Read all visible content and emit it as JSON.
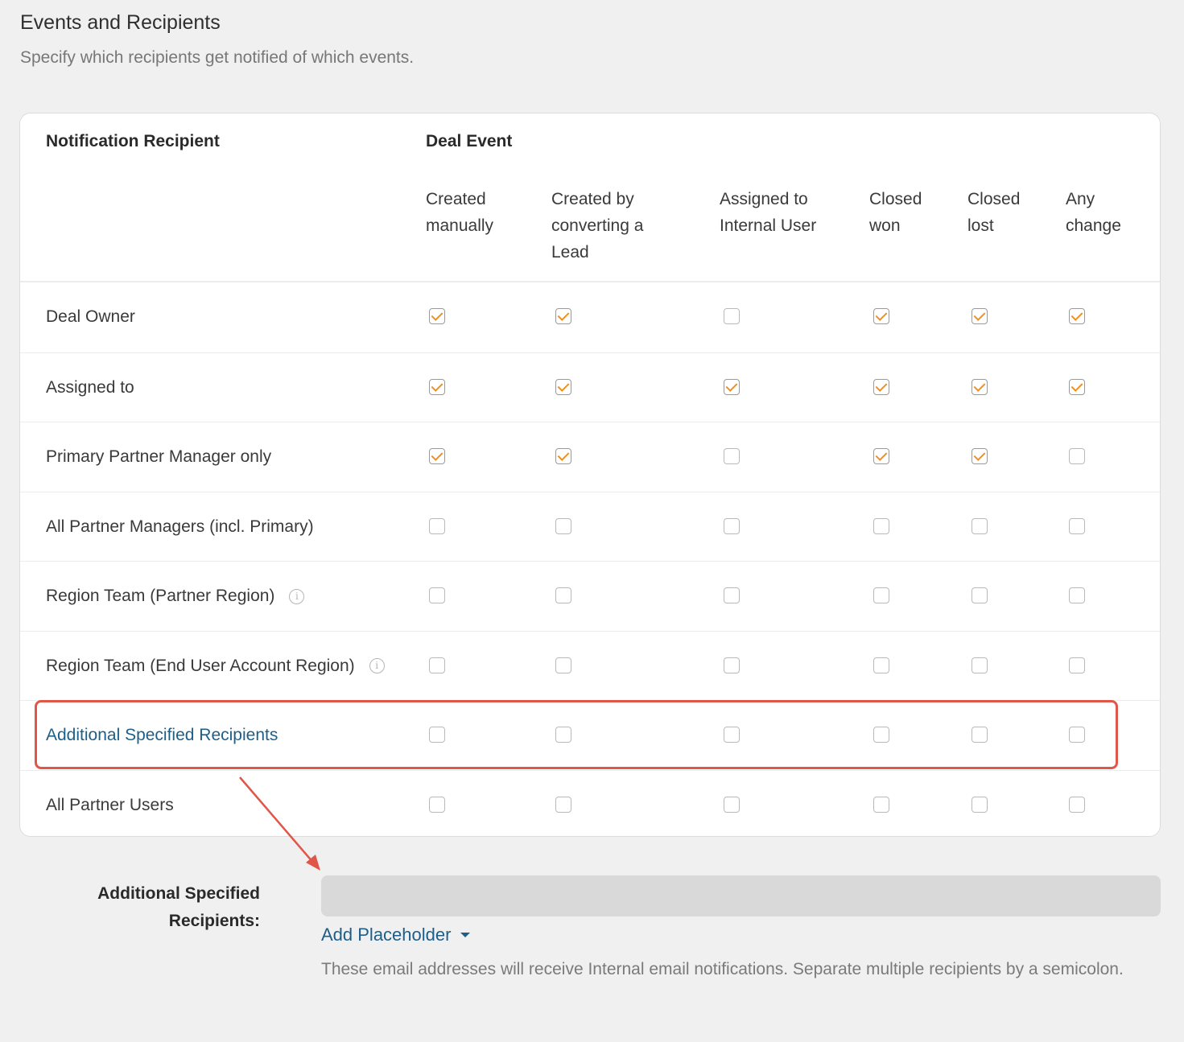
{
  "section": {
    "title": "Events and Recipients",
    "subtitle": "Specify which recipients get notified of which events."
  },
  "table": {
    "recipient_header": "Notification Recipient",
    "event_header": "Deal Event",
    "columns": [
      "Created\nmanually",
      "Created by\nconverting a\nLead",
      "Assigned to\nInternal User",
      "Closed\nwon",
      "Closed\nlost",
      "Any\nchange"
    ],
    "rows": [
      {
        "label": "Deal Owner",
        "info": false,
        "link": false,
        "checked": [
          true,
          true,
          false,
          true,
          true,
          true
        ]
      },
      {
        "label": "Assigned to",
        "info": false,
        "link": false,
        "checked": [
          true,
          true,
          true,
          true,
          true,
          true
        ]
      },
      {
        "label": "Primary Partner Manager only",
        "info": false,
        "link": false,
        "checked": [
          true,
          true,
          false,
          true,
          true,
          false
        ]
      },
      {
        "label": "All Partner Managers (incl. Primary)",
        "info": false,
        "link": false,
        "checked": [
          false,
          false,
          false,
          false,
          false,
          false
        ]
      },
      {
        "label": "Region Team (Partner Region)",
        "info": true,
        "link": false,
        "checked": [
          false,
          false,
          false,
          false,
          false,
          false
        ]
      },
      {
        "label": "Region Team (End User Account Region)",
        "info": true,
        "link": false,
        "checked": [
          false,
          false,
          false,
          false,
          false,
          false
        ]
      },
      {
        "label": "Additional Specified Recipients",
        "info": false,
        "link": true,
        "checked": [
          false,
          false,
          false,
          false,
          false,
          false
        ]
      },
      {
        "label": "All Partner Users",
        "info": false,
        "link": false,
        "checked": [
          false,
          false,
          false,
          false,
          false,
          false
        ]
      }
    ]
  },
  "additional": {
    "label": "Additional Specified Recipients:",
    "value": "",
    "add_placeholder_label": "Add Placeholder",
    "help_text": "These email addresses will receive Internal email notifications. Separate multiple recipients by a semicolon."
  },
  "annotation": {
    "highlight_color": "#e0574a"
  },
  "colors": {
    "check": "#f0901e",
    "link": "#1c5f8a"
  }
}
